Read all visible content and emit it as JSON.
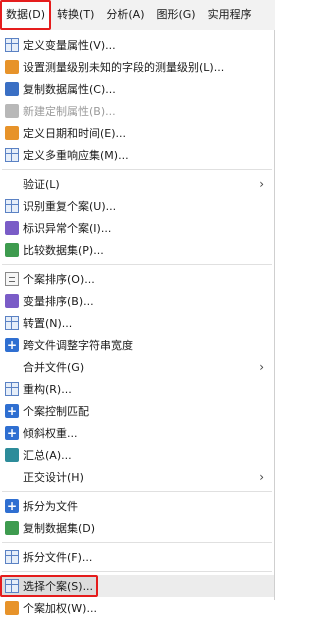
{
  "menubar": {
    "items": [
      {
        "label": "数据(D)"
      },
      {
        "label": "转换(T)"
      },
      {
        "label": "分析(A)"
      },
      {
        "label": "图形(G)"
      },
      {
        "label": "实用程序"
      }
    ]
  },
  "menu": {
    "items": [
      {
        "label": "定义变量属性(V)..."
      },
      {
        "label": "设置测量级别未知的字段的测量级别(L)..."
      },
      {
        "label": "复制数据属性(C)..."
      },
      {
        "label": "新建定制属性(B)..."
      },
      {
        "label": "定义日期和时间(E)..."
      },
      {
        "label": "定义多重响应集(M)..."
      },
      {
        "label": "验证(L)"
      },
      {
        "label": "识别重复个案(U)..."
      },
      {
        "label": "标识异常个案(I)..."
      },
      {
        "label": "比较数据集(P)..."
      },
      {
        "label": "个案排序(O)..."
      },
      {
        "label": "变量排序(B)..."
      },
      {
        "label": "转置(N)..."
      },
      {
        "label": "跨文件调整字符串宽度"
      },
      {
        "label": "合并文件(G)"
      },
      {
        "label": "重构(R)..."
      },
      {
        "label": "个案控制匹配"
      },
      {
        "label": "倾斜权重..."
      },
      {
        "label": "汇总(A)..."
      },
      {
        "label": "正交设计(H)"
      },
      {
        "label": "拆分为文件"
      },
      {
        "label": "复制数据集(D)"
      },
      {
        "label": "拆分文件(F)..."
      },
      {
        "label": "选择个案(S)..."
      },
      {
        "label": "个案加权(W)..."
      }
    ],
    "arrow": "›"
  }
}
